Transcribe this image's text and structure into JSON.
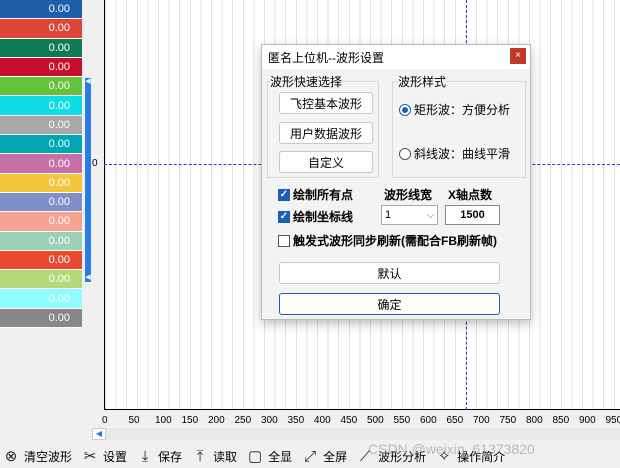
{
  "channels": [
    {
      "value": "0.00",
      "color": "#1f5fa8"
    },
    {
      "value": "0.00",
      "color": "#e0453a"
    },
    {
      "value": "0.00",
      "color": "#0f7a56"
    },
    {
      "value": "0.00",
      "color": "#c8102e"
    },
    {
      "value": "0.00",
      "color": "#66c23a"
    },
    {
      "value": "0.00",
      "color": "#0fdbe6"
    },
    {
      "value": "0.00",
      "color": "#a8a8a8"
    },
    {
      "value": "0.00",
      "color": "#00a7b3"
    },
    {
      "value": "0.00",
      "color": "#c86fa8"
    },
    {
      "value": "0.00",
      "color": "#f2c53a"
    },
    {
      "value": "0.00",
      "color": "#7f8fc8"
    },
    {
      "value": "0.00",
      "color": "#f4a393"
    },
    {
      "value": "0.00",
      "color": "#9bd1b6"
    },
    {
      "value": "0.00",
      "color": "#e84a2f"
    },
    {
      "value": "0.00",
      "color": "#b3d97a"
    },
    {
      "value": "0.00",
      "color": "#8ffcff"
    },
    {
      "value": "0.00",
      "color": "#888888"
    }
  ],
  "plot": {
    "y_zero_label": "0",
    "x_ticks": [
      "0",
      "50",
      "100",
      "150",
      "200",
      "250",
      "300",
      "350",
      "400",
      "450",
      "500",
      "550",
      "600",
      "650",
      "700",
      "750",
      "800",
      "850",
      "900",
      "950"
    ]
  },
  "dialog": {
    "title": "匿名上位机--波形设置",
    "close": "×",
    "quick_select": {
      "label": "波形快速选择",
      "buttons": [
        "飞控基本波形",
        "用户数据波形",
        "自定义"
      ]
    },
    "style": {
      "label": "波形样式",
      "options": [
        {
          "label": "矩形波：方便分析",
          "selected": true
        },
        {
          "label": "斜线波：曲线平滑",
          "selected": false
        }
      ]
    },
    "draw_all_points": {
      "label": "绘制所有点",
      "checked": true
    },
    "draw_axis": {
      "label": "绘制坐标线",
      "checked": true
    },
    "trigger_sync": {
      "label": "触发式波形同步刷新(需配合FB刷新帧)",
      "checked": false
    },
    "line_width": {
      "label": "波形线宽",
      "value": "1"
    },
    "x_points": {
      "label": "X轴点数",
      "value": "1500"
    },
    "default_button": "默认",
    "ok_button": "确定"
  },
  "toolbar": [
    {
      "label": "清空波形",
      "icon": "clear-wave-icon",
      "glyph": "⊗"
    },
    {
      "label": "设置",
      "icon": "tools-icon",
      "glyph": "✂"
    },
    {
      "label": "保存",
      "icon": "download-icon",
      "glyph": "⤓"
    },
    {
      "label": "读取",
      "icon": "upload-icon",
      "glyph": "⤒"
    },
    {
      "label": "全显",
      "icon": "frame-icon",
      "glyph": "▢"
    },
    {
      "label": "全屏",
      "icon": "fullscreen-icon",
      "glyph": "⤢"
    },
    {
      "label": "波形分析",
      "icon": "chart-icon",
      "glyph": "⟋"
    },
    {
      "label": "操作简介",
      "icon": "help-icon",
      "glyph": "✧"
    }
  ],
  "watermark": "CSDN @weixin_61373820"
}
